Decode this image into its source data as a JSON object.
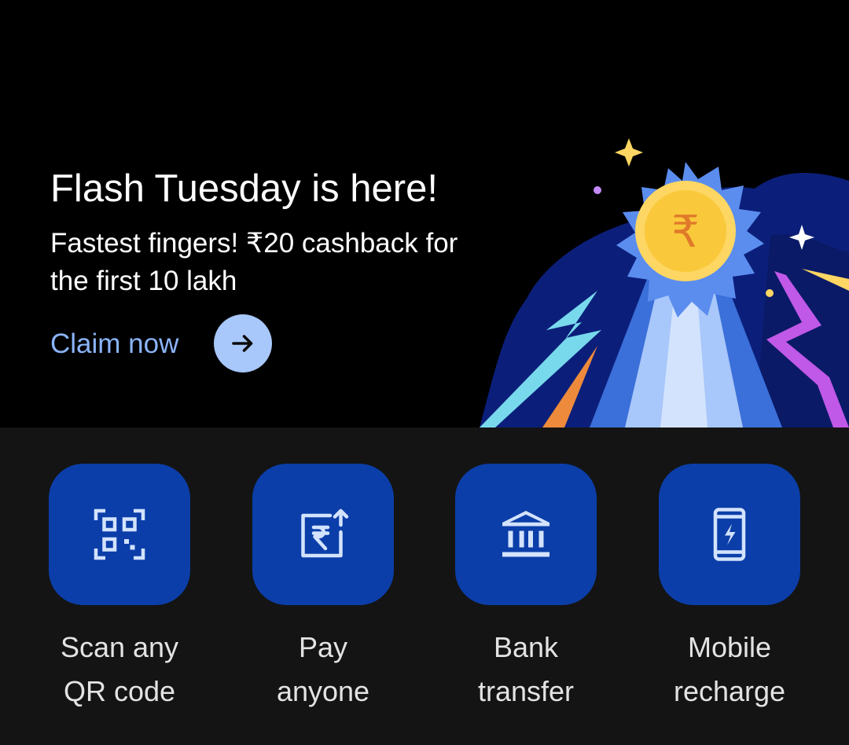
{
  "promo": {
    "title": "Flash Tuesday is here!",
    "subtitle": "Fastest fingers! ₹20 cashback for the first 10 lakh",
    "cta_label": "Claim now",
    "cta_icon": "arrow-right-icon",
    "coin_symbol": "₹",
    "colors": {
      "background": "#000000",
      "link": "#8ab4f8",
      "cta_circle": "#a8c7fa"
    }
  },
  "quick_actions": [
    {
      "label_line1": "Scan any",
      "label_line2": "QR code",
      "icon": "qr-scan-icon"
    },
    {
      "label_line1": "Pay",
      "label_line2": "anyone",
      "icon": "pay-rupee-icon"
    },
    {
      "label_line1": "Bank",
      "label_line2": "transfer",
      "icon": "bank-icon"
    },
    {
      "label_line1": "Mobile",
      "label_line2": "recharge",
      "icon": "mobile-recharge-icon"
    }
  ],
  "colors": {
    "tile": "#0b3ea8",
    "tile_icon": "#d3e3fd",
    "label": "#e3e3e3",
    "panel": "#141414"
  }
}
